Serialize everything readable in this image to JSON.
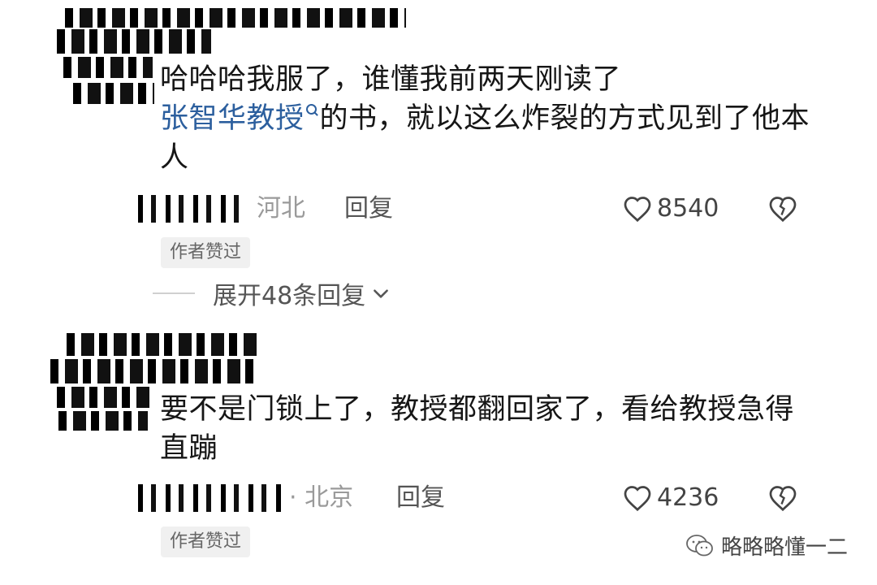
{
  "comments": [
    {
      "text_before": "哈哈哈我服了，谁懂我前两天刚读了",
      "mention": "张智华教授",
      "text_after": "的书，就以这么炸裂的方式见到了他本人",
      "location": "河北",
      "reply_label": "回复",
      "likes": "8540",
      "badge": "作者赞过",
      "expand_label": "展开48条回复"
    },
    {
      "text": "要不是门锁上了，教授都翻回家了，看给教授急得直蹦",
      "location": "· 北京",
      "reply_label": "回复",
      "likes": "4236",
      "badge": "作者赞过"
    }
  ],
  "watermark": {
    "text": "略略略懂一二",
    "icon": "wechat-icon"
  },
  "colors": {
    "mention": "#2c5f9e",
    "location": "#9a9a9a",
    "badge_bg": "#f0f0f0"
  }
}
